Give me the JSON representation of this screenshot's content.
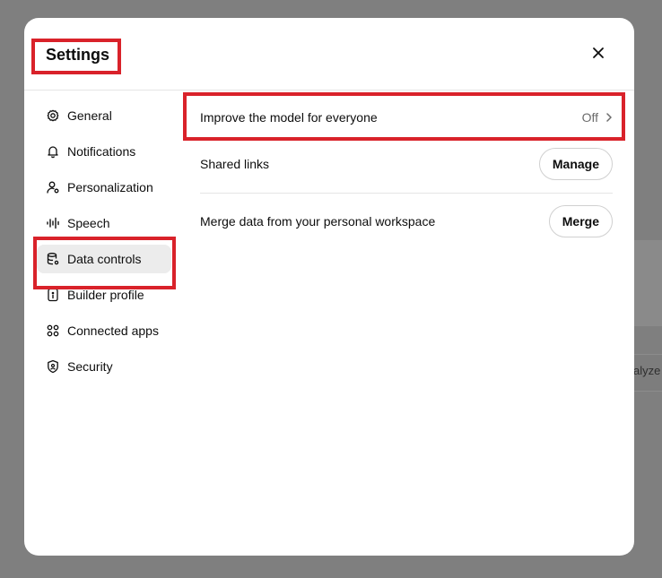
{
  "background": {
    "partial_text": "alyze"
  },
  "dialog": {
    "title": "Settings",
    "close_icon": "close-icon"
  },
  "sidebar": {
    "items": [
      {
        "label": "General",
        "icon": "gear-icon",
        "active": false
      },
      {
        "label": "Notifications",
        "icon": "bell-icon",
        "active": false
      },
      {
        "label": "Personalization",
        "icon": "user-settings-icon",
        "active": false
      },
      {
        "label": "Speech",
        "icon": "waveform-icon",
        "active": false
      },
      {
        "label": "Data controls",
        "icon": "database-icon",
        "active": true
      },
      {
        "label": "Builder profile",
        "icon": "id-card-icon",
        "active": false
      },
      {
        "label": "Connected apps",
        "icon": "apps-grid-icon",
        "active": false
      },
      {
        "label": "Security",
        "icon": "shield-icon",
        "active": false
      }
    ]
  },
  "content": {
    "improve_model": {
      "label": "Improve the model for everyone",
      "status": "Off",
      "icon": "chevron-right-icon"
    },
    "shared_links": {
      "label": "Shared links",
      "button": "Manage"
    },
    "merge_data": {
      "label": "Merge data from your personal workspace",
      "button": "Merge"
    }
  },
  "colors": {
    "overlay": "#7f7f7f",
    "dialog_bg": "#ffffff",
    "active_item_bg": "#ececec",
    "highlight": "#d9222a",
    "muted_text": "#6b6b6b"
  }
}
